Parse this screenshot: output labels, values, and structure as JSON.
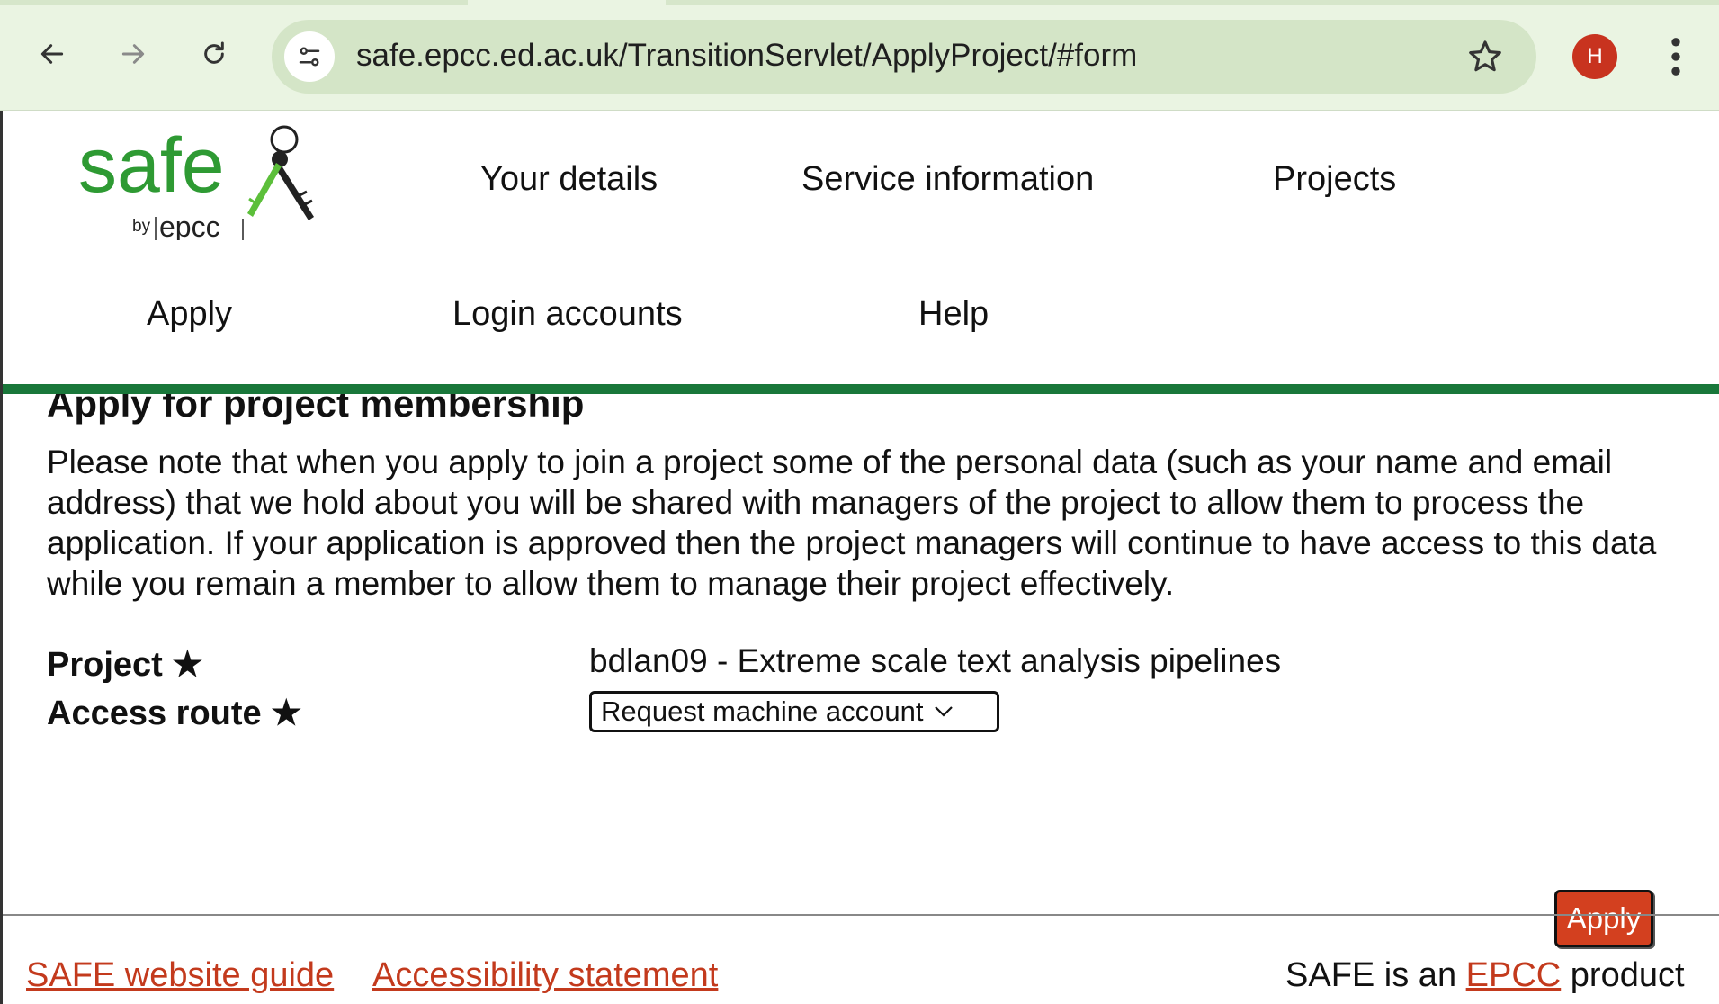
{
  "browser": {
    "url": "safe.epcc.ed.ac.uk/TransitionServlet/ApplyProject/#form",
    "avatar_initial": "H",
    "icons": [
      "back-icon",
      "forward-icon",
      "reload-icon",
      "site-info-icon",
      "bookmark-star-icon",
      "menu-kebab-icon"
    ]
  },
  "logo": {
    "word": "safe",
    "by": "by",
    "org": "epcc",
    "colors": {
      "brand_green": "#2e9a33",
      "key_green": "#5cbf3a"
    }
  },
  "nav": {
    "your_details": "Your details",
    "service_information": "Service information",
    "projects": "Projects",
    "apply": "Apply",
    "login_accounts": "Login accounts",
    "help": "Help"
  },
  "main": {
    "title": "Apply for project membership",
    "intro": "Please note that when you apply to join a project some of the personal data (such as your name and email address) that we hold about you will be shared with managers of the project to allow them to process the application. If your application is approved then the project managers will continue to have access to this data while you remain a member to allow them to manage their project effectively.",
    "project_label": "Project ★",
    "project_value": "bdlan09 - Extreme scale text analysis pipelines",
    "access_route_label": "Access route ★",
    "access_route_selected": "Request machine account",
    "apply_button": "Apply"
  },
  "footer": {
    "guide_link": "SAFE website guide",
    "accessibility_link": "Accessibility statement",
    "product_prefix": "SAFE is an",
    "product_link": "EPCC",
    "product_suffix": "product"
  },
  "colors": {
    "accent_green": "#19773a",
    "button_red": "#d3401f",
    "link_red": "#c33a1d",
    "chrome_bg": "#eaf4e2"
  }
}
